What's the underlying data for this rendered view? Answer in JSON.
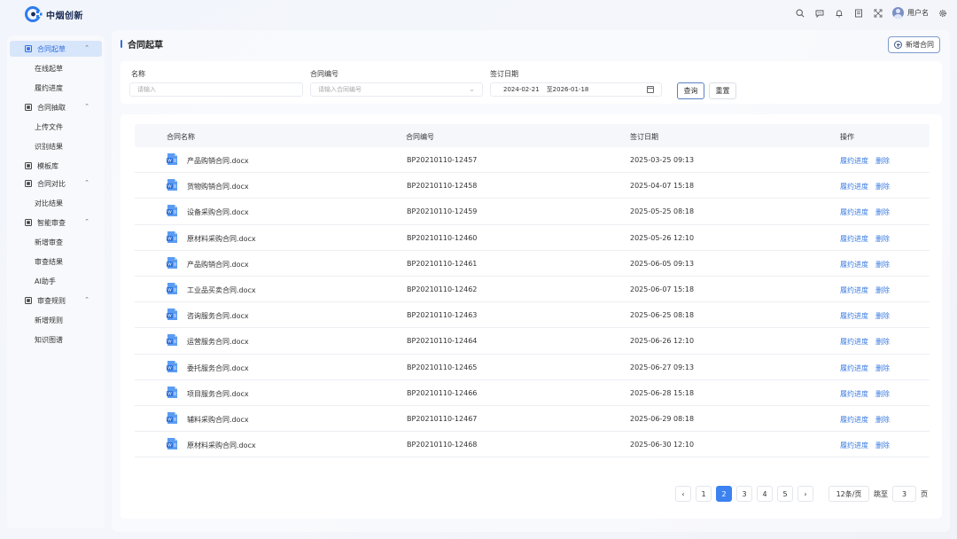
{
  "app": {
    "brand": "中烟创新",
    "user_name": "用户名"
  },
  "sidebar": {
    "groups": [
      {
        "label": "合同起草",
        "items": [
          "在线起草",
          "履约进度"
        ]
      },
      {
        "label": "合同抽取",
        "items": [
          "上传文件",
          "识别结果"
        ]
      },
      {
        "label": "模板库",
        "items": []
      },
      {
        "label": "合同对比",
        "items": [
          "对比结果"
        ]
      },
      {
        "label": "智能审查",
        "items": [
          "新增审查",
          "审查结果",
          "AI助手"
        ]
      },
      {
        "label": "审查规则",
        "items": [
          "新增规则",
          "知识图谱"
        ]
      }
    ]
  },
  "page": {
    "title": "合同起草",
    "new_button": "新增合同"
  },
  "filter": {
    "name_label": "名称",
    "name_placeholder": "请输入",
    "code_label": "合同编号",
    "code_placeholder": "请输入合同编号",
    "date_label": "签订日期",
    "date_start": "2024-02-21",
    "date_end": "至2026-01-18",
    "query_button": "查询",
    "reset_button": "重置"
  },
  "table": {
    "columns": [
      "合同名称",
      "合同编号",
      "签订日期",
      "操作"
    ],
    "action_progress": "履约进度",
    "action_delete": "删除",
    "rows": [
      {
        "name": "产品购销合同.docx",
        "code": "BP20210110-12457",
        "date": "2025-03-25  09:13"
      },
      {
        "name": "货物购销合同.docx",
        "code": "BP20210110-12458",
        "date": "2025-04-07  15:18"
      },
      {
        "name": "设备采购合同.docx",
        "code": "BP20210110-12459",
        "date": "2025-05-25  08:18"
      },
      {
        "name": "原材料采购合同.docx",
        "code": "BP20210110-12460",
        "date": "2025-05-26  12:10"
      },
      {
        "name": "产品购销合同.docx",
        "code": "BP20210110-12461",
        "date": "2025-06-05  09:13"
      },
      {
        "name": "工业品买卖合同.docx",
        "code": "BP20210110-12462",
        "date": "2025-06-07  15:18"
      },
      {
        "name": "咨询服务合同.docx",
        "code": "BP20210110-12463",
        "date": "2025-06-25  08:18"
      },
      {
        "name": "运营服务合同.docx",
        "code": "BP20210110-12464",
        "date": "2025-06-26  12:10"
      },
      {
        "name": "委托服务合同.docx",
        "code": "BP20210110-12465",
        "date": "2025-06-27  09:13"
      },
      {
        "name": "项目服务合同.docx",
        "code": "BP20210110-12466",
        "date": "2025-06-28  15:18"
      },
      {
        "name": "辅料采购合同.docx",
        "code": "BP20210110-12467",
        "date": "2025-06-29  08:18"
      },
      {
        "name": "原材料采购合同.docx",
        "code": "BP20210110-12468",
        "date": "2025-06-30  12:10"
      }
    ]
  },
  "pagination": {
    "pages": [
      "1",
      "2",
      "3",
      "4",
      "5"
    ],
    "current": "2",
    "prev": "‹",
    "next": "›",
    "page_size": "12条/页",
    "jump_label": "跳至",
    "jump_value": "3",
    "page_suffix": "页"
  },
  "colors": {
    "accent": "#3c82f0",
    "link": "#3a7be0",
    "sidebar_active_bg": "#d8e6fb"
  }
}
